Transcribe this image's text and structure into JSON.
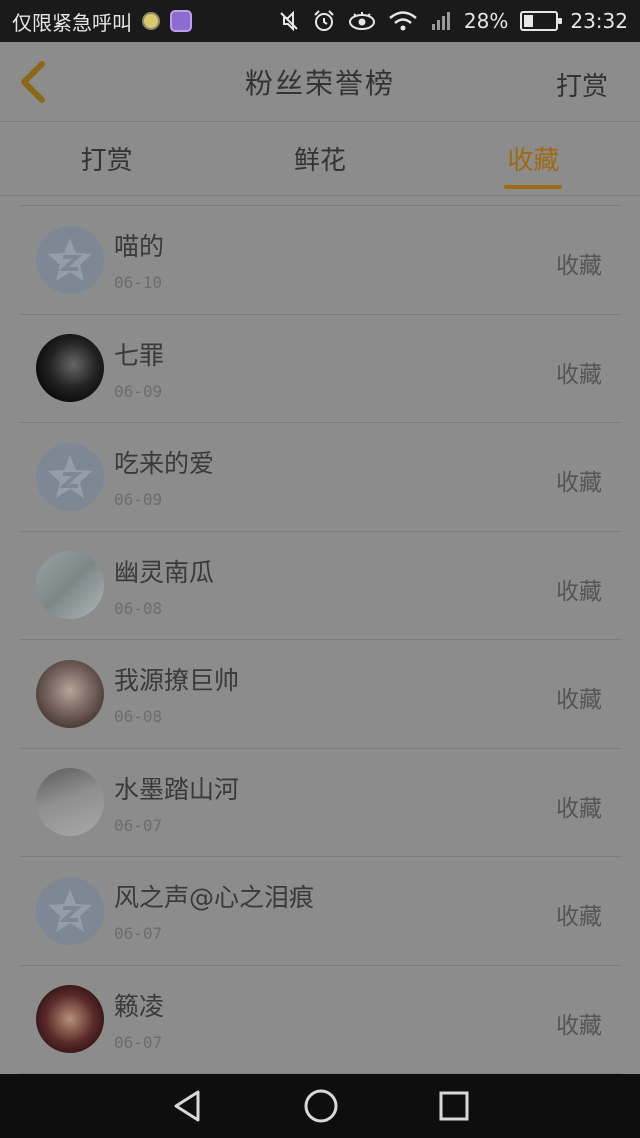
{
  "status_bar": {
    "carrier_text": "仅限紧急呼叫",
    "battery_percent": "28%",
    "battery_level": 0.28,
    "time": "23:32",
    "icons": [
      "qq-icon",
      "gallery-icon",
      "mute-icon",
      "alarm-icon",
      "eye-icon",
      "wifi-icon",
      "signal-icon",
      "battery-icon"
    ]
  },
  "header": {
    "title": "粉丝荣誉榜",
    "action_label": "打赏"
  },
  "tabs": [
    {
      "label": "打赏",
      "active": false
    },
    {
      "label": "鲜花",
      "active": false
    },
    {
      "label": "收藏",
      "active": true
    }
  ],
  "fans": [
    {
      "name": "喵的",
      "date": "06-10",
      "action": "收藏",
      "avatar": "qq-default"
    },
    {
      "name": "七罪",
      "date": "06-09",
      "action": "收藏",
      "avatar": "dark-photo"
    },
    {
      "name": "吃来的爱",
      "date": "06-09",
      "action": "收藏",
      "avatar": "qq-default"
    },
    {
      "name": "幽灵南瓜",
      "date": "06-08",
      "action": "收藏",
      "avatar": "pale-photo"
    },
    {
      "name": "我源撩巨帅",
      "date": "06-08",
      "action": "收藏",
      "avatar": "girl-photo"
    },
    {
      "name": "水墨踏山河",
      "date": "06-07",
      "action": "收藏",
      "avatar": "ink-photo"
    },
    {
      "name": "风之声@心之泪痕",
      "date": "06-07",
      "action": "收藏",
      "avatar": "qq-default"
    },
    {
      "name": "籁凌",
      "date": "06-07",
      "action": "收藏",
      "avatar": "anime-photo"
    }
  ],
  "nav_bar": {
    "icons": [
      "back-triangle-icon",
      "home-circle-icon",
      "recents-square-icon"
    ]
  }
}
